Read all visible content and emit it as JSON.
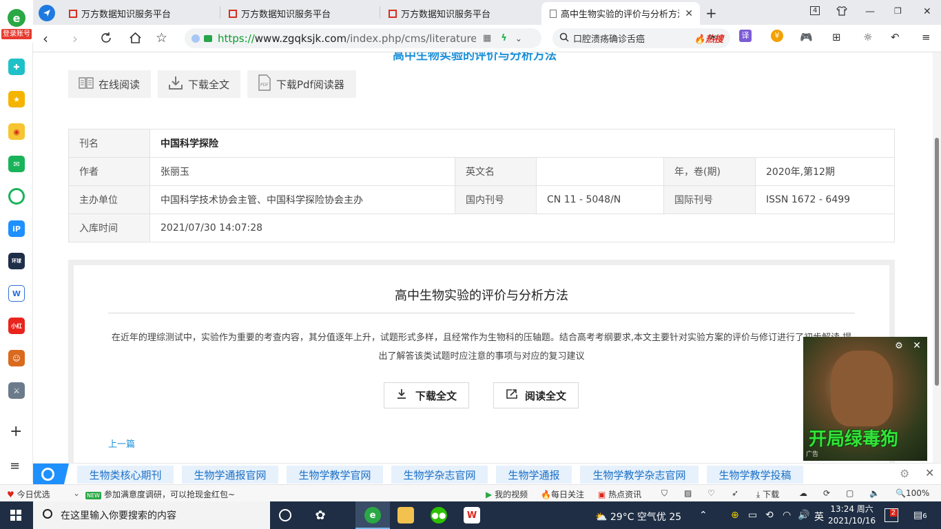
{
  "browser": {
    "login_label": "登录账号",
    "tabs": [
      {
        "title": "万方数据知识服务平台"
      },
      {
        "title": "万方数据知识服务平台"
      },
      {
        "title": "万方数据知识服务平台"
      },
      {
        "title": "高中生物实验的评价与分析方法"
      }
    ],
    "tab_count": "4",
    "url_prefix": "https://",
    "url_host": "www.zgqksjk.com",
    "url_path": "/index.php/cms/literature/show",
    "search_text": "口腔溃疡确诊舌癌",
    "search_hot": "热搜"
  },
  "page": {
    "head_title": "高中生物实验的评价与分析方法",
    "actions": {
      "read_online": "在线阅读",
      "download_full": "下载全文",
      "download_reader": "下载Pdf阅读器"
    },
    "meta": {
      "journal_label": "刊名",
      "journal_value": "中国科学探险",
      "author_label": "作者",
      "author_value": "张丽玉",
      "en_name_label": "英文名",
      "en_name_value": "",
      "year_label": "年，卷(期)",
      "year_value": "2020年,第12期",
      "sponsor_label": "主办单位",
      "sponsor_value": "中国科学技术协会主管、中国科学探险协会主办",
      "cn_label": "国内刊号",
      "cn_value": "CN 11 - 5048/N",
      "issn_label": "国际刊号",
      "issn_value": "ISSN 1672 - 6499",
      "date_label": "入库时间",
      "date_value": "2021/07/30 14:07:28"
    },
    "article": {
      "title": "高中生物实验的评价与分析方法",
      "abstract": "在近年的理综测试中，实验作为重要的考查内容，其分值逐年上升，试题形式多样，且经常作为生物科的压轴题。结合高考考纲要求,本文主要针对实验方案的评价与修订进行了初步解读,提出了解答该类试题时应注意的事项与对应的复习建议",
      "download_btn": "下载全文",
      "read_btn": "阅读全文",
      "prev_link": "上一篇"
    }
  },
  "ad": {
    "text": "开局绿毒狗",
    "label": "广告"
  },
  "keywords": [
    "生物类核心期刊",
    "生物学通报官网",
    "生物学教学官网",
    "生物学杂志官网",
    "生物学通报",
    "生物学教学杂志官网",
    "生物学教学投稿"
  ],
  "statusbar": {
    "today": "今日优选",
    "news_badge": "NEW",
    "news": "参加满意度调研，可以抢现金红包~",
    "my_video": "我的视频",
    "daily": "每日关注",
    "hot": "热点资讯",
    "download": "下载",
    "zoom": "100%"
  },
  "taskbar": {
    "search_placeholder": "在这里输入你要搜索的内容",
    "weather": "29°C  空气优 25",
    "ime": "英",
    "time": "13:24 周六",
    "date": "2021/10/16",
    "notif_badge": "2",
    "notif_count": "6"
  }
}
